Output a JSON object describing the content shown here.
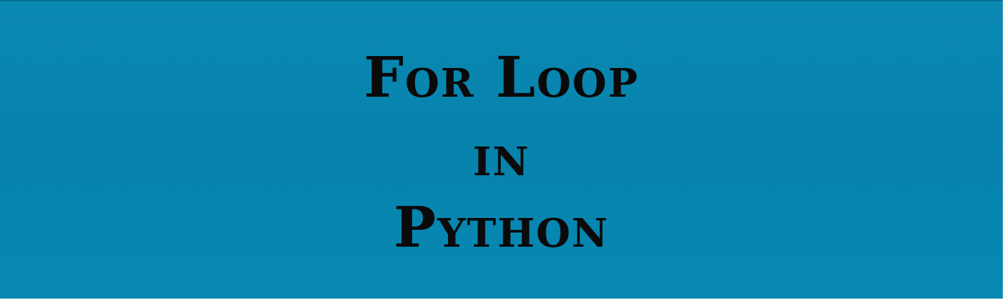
{
  "title": {
    "line1": "For Loop",
    "line2": "in",
    "line3": "Python"
  },
  "colors": {
    "background": "#0686b0",
    "text": "#0a0a0a"
  }
}
